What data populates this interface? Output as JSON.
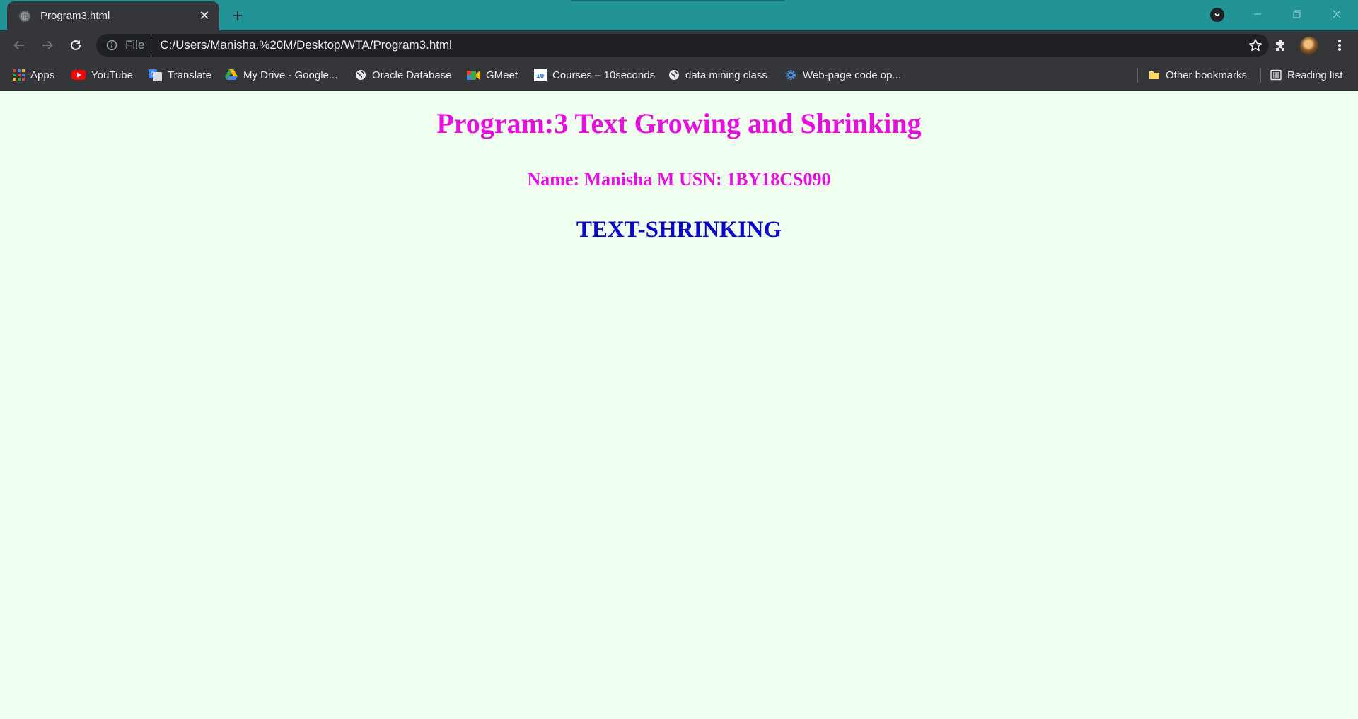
{
  "browser": {
    "tab": {
      "title": "Program3.html",
      "close_glyph": "✕"
    },
    "new_tab_glyph": "+",
    "address": {
      "scheme_label": "File",
      "url": "C:/Users/Manisha.%20M/Desktop/WTA/Program3.html"
    },
    "bookmarks": [
      {
        "label": "Apps",
        "icon": "apps-grid-icon"
      },
      {
        "label": "YouTube",
        "icon": "youtube-icon"
      },
      {
        "label": "Translate",
        "icon": "translate-icon"
      },
      {
        "label": "My Drive - Google...",
        "icon": "google-drive-icon"
      },
      {
        "label": "Oracle Database",
        "icon": "globe-icon"
      },
      {
        "label": "GMeet",
        "icon": "google-meet-icon"
      },
      {
        "label": "Courses – 10seconds",
        "icon": "courses-icon"
      },
      {
        "label": "data mining class",
        "icon": "globe-icon"
      },
      {
        "label": "Web-page code op...",
        "icon": "gear-icon"
      }
    ],
    "other_bookmarks": {
      "label": "Other bookmarks",
      "icon": "folder-icon"
    },
    "reading_list": {
      "label": "Reading list",
      "icon": "reading-list-icon"
    }
  },
  "page": {
    "title": "Program:3 Text Growing and Shrinking",
    "name_line": "Name: Manisha M USN: 1BY18CS090",
    "animated_text": "TEXT-SHRINKING"
  },
  "colors": {
    "tabstrip": "#229497",
    "chrome_dark": "#35363a",
    "page_bg": "#f0fff0",
    "magenta": "#e60fe0",
    "blue": "#0a06cc"
  }
}
